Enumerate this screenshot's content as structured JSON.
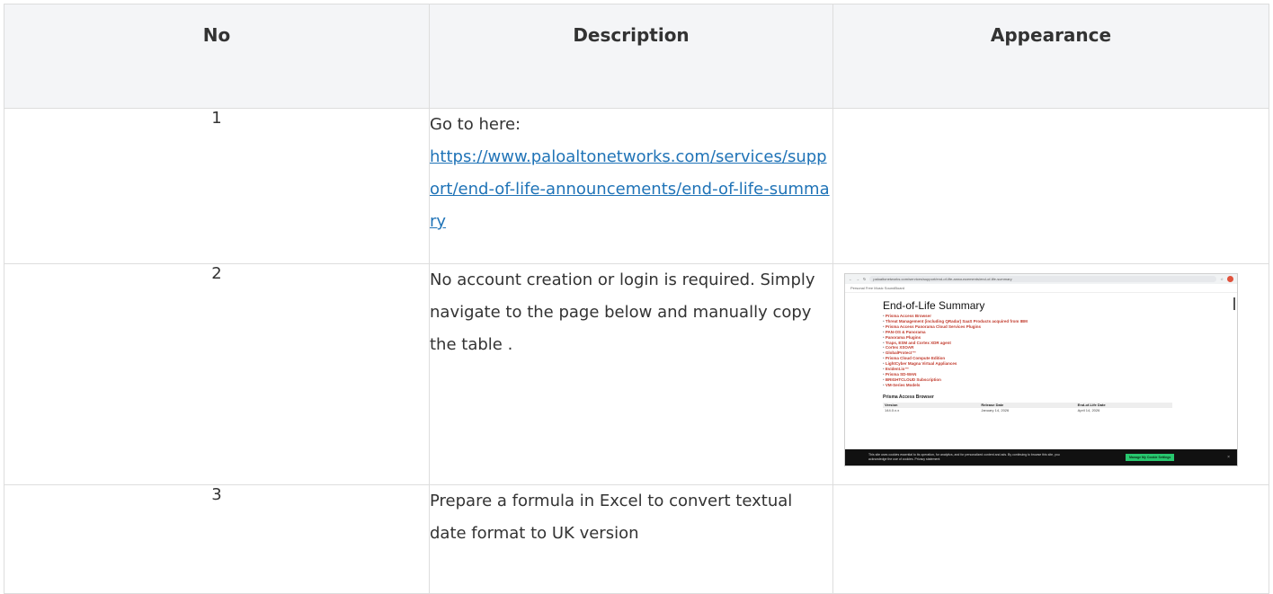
{
  "headers": {
    "no": "No",
    "description": "Description",
    "appearance": "Appearance"
  },
  "rows": [
    {
      "no": "1",
      "text": "Go to here:",
      "link": "https://www.paloaltonetworks.com/services/support/end-of-life-announcements/end-of-life-summary"
    },
    {
      "no": "2",
      "text": "No account creation or login is required. Simply navigate to the page below and manually copy the table ."
    },
    {
      "no": "3",
      "text": "Prepare a formula in Excel to convert textual date format to UK version"
    }
  ],
  "screenshot": {
    "url": "paloaltonetworks.com/services/support/end-of-life-announcements/end-of-life-summary",
    "bookmarks": "Personal   Free Music   SoundBoard",
    "title": "End-of-Life Summary",
    "items": [
      "Prisma Access Browser",
      "Threat Management (including QRadar) SaaS Products acquired from IBM",
      "Prisma Access Panorama Cloud Services Plugins",
      "PAN-OS & Panorama",
      "Panorama Plugins",
      "Traps, ESM and Cortex XDR agent",
      "Cortex XSOAR",
      "GlobalProtect™",
      "Prisma Cloud Compute Edition",
      "LightCyber Magna Virtual Appliances",
      "Evident.io™",
      "Prisma SD-WAN",
      "BRIGHTCLOUD Subscription",
      "VM-Series Models"
    ],
    "section": "Prisma Access Browser",
    "table_headers": [
      "Version",
      "Release Date",
      "End-of-Life Date"
    ],
    "table_row": [
      "144.0.x.x",
      "January 14, 2026",
      "April 14, 2026"
    ],
    "cookie_text": "This site uses cookies essential to its operation, for analytics, and for personalized content and ads. By continuing to browse this site, you acknowledge the use of cookies.  Privacy statement",
    "cookie_button": "Manage My Cookie Settings",
    "close": "×"
  }
}
